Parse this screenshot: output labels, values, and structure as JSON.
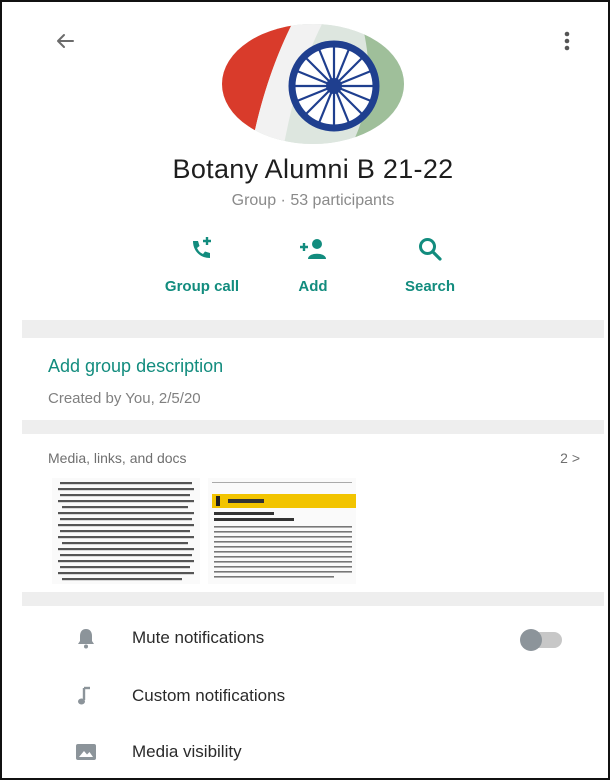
{
  "header": {
    "back_icon": "arrow-left-icon",
    "menu_icon": "more-vertical-icon"
  },
  "group": {
    "name": "Botany Alumni B 21-22",
    "subtitle": "Group · 53 participants"
  },
  "actions": [
    {
      "label": "Group call",
      "icon": "add-call-icon"
    },
    {
      "label": "Add",
      "icon": "add-person-icon"
    },
    {
      "label": "Search",
      "icon": "search-icon"
    }
  ],
  "description": {
    "link": "Add group description",
    "created": "Created by You, 2/5/20"
  },
  "media": {
    "title": "Media, links, and docs",
    "count": "2 >"
  },
  "settings": [
    {
      "label": "Mute notifications",
      "icon": "bell-icon",
      "toggle": false
    },
    {
      "label": "Custom notifications",
      "icon": "music-note-icon"
    },
    {
      "label": "Media visibility",
      "icon": "image-icon"
    }
  ],
  "colors": {
    "accent": "#128c7e",
    "divider": "#eeeeee",
    "icon_grey": "#8c949a"
  }
}
